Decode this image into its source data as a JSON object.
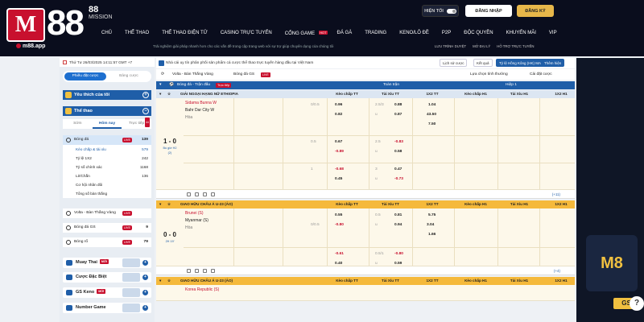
{
  "header": {
    "brand_main": "M",
    "brand_num": "88",
    "brand_badge": "88",
    "brand_sub": "MISSION",
    "app_link": "m88.app",
    "hide_label": "HIỆN TỐI",
    "login_label": "ĐĂNG NHẬP",
    "register_label": "ĐĂNG KÝ",
    "nav": [
      {
        "label": "CHỦ",
        "active": false
      },
      {
        "label": "THỂ THAO",
        "active": true
      },
      {
        "label": "THỂ THAO ĐIỆN TỬ",
        "active": false
      },
      {
        "label": "CASINO TRỰC TUYẾN",
        "active": false
      },
      {
        "label": "CỔNG GAME",
        "active": false,
        "badge": "HOT"
      },
      {
        "label": "ĐÁ GÀ",
        "active": false
      },
      {
        "label": "TRADING",
        "active": false
      },
      {
        "label": "KENO/LÔ ĐỀ",
        "active": false
      },
      {
        "label": "P2P",
        "active": false
      },
      {
        "label": "ĐỘC QUYỀN",
        "active": false
      },
      {
        "label": "KHUYẾN MÃI",
        "active": false
      },
      {
        "label": "VIP",
        "active": false
      }
    ],
    "marquee": "Trải nghiệm giải pháp nhanh hơn cho các vấn đề trong cập trang web với sự trợ giúp chuyên dụng của chúng tôi",
    "sub_links": [
      "LƯU TRÌNH DUYỆT",
      "MỞ ĐẠI LÝ",
      "HỖ TRỢ TRỰC TUYẾN"
    ],
    "datetime": "26/03/2025 14:12 (GMT+7)"
  },
  "left": {
    "datetime": "Thứ Tư 26/03/2025 14:11:57 GMT +7",
    "bet_tabs": [
      "Phiếu đặt cược",
      "Bảng cược"
    ],
    "favorites": "Yêu thích của tôi",
    "sports_header": "Thể thao",
    "sub_tabs": [
      {
        "label": "Sớm",
        "active": false
      },
      {
        "label": "Hôm nay",
        "active": true
      },
      {
        "label": "Trực tiếp",
        "active": false,
        "count": "44"
      }
    ],
    "football": {
      "label": "Bóng đá",
      "live": "LIVE",
      "count": "139"
    },
    "sub_items": [
      {
        "label": "Kèo chấp & tài xỉu",
        "count": "579",
        "selected": true
      },
      {
        "label": "Tỷ lệ 1X2",
        "count": "242"
      },
      {
        "label": "Tỷ số chính xác",
        "count": "1168"
      },
      {
        "label": "Lẻ/Chẵn",
        "count": "136"
      },
      {
        "label": "Cơ hội nhân đôi",
        "count": ""
      },
      {
        "label": "Tổng số bàn thắng",
        "count": ""
      }
    ],
    "other_sports": [
      {
        "label": "Volta - Bàn Thắng Vàng",
        "live": "LIVE",
        "count": ""
      },
      {
        "label": "Bóng đá GS",
        "live": "LIVE",
        "count": "9"
      },
      {
        "label": "Bóng rổ",
        "live": "LIVE",
        "count": "79"
      }
    ],
    "bottom_items": [
      {
        "label": "Muay Thai",
        "badge": "MỚI"
      },
      {
        "label": "Cược Đặc Biệt",
        "badge": ""
      },
      {
        "label": "GS Keno",
        "badge": "MỚI"
      },
      {
        "label": "Number Game",
        "badge": ""
      }
    ]
  },
  "main": {
    "topbar_text": "Nhà cái uy tín phân phối sản phẩm cá cược thể thao trực tuyến hàng đầu tại Việt Nam",
    "top_right": [
      "Lịch sử cược",
      "Kết quả",
      "Tỷ lệ Hồng Kông (HK) MALAY",
      "Thêm hiện"
    ],
    "sport_title": "Bóng đá - Trận đấu",
    "live_badge": "Trực tiếp",
    "volta_tab": "Volta - Bàn Thắng Vàng",
    "gs_tab": "Bóng đá GS",
    "gs_badge": "LIVE",
    "sort_label": "Lựa chọn tính thường",
    "settings_label": "Cài đặt cược",
    "col_full": "Toàn trận",
    "col_half": "Hiệp 1",
    "col_heads": [
      "Kèo chấp TT",
      "Tài Xỉu TT",
      "1X2 TT",
      "Kèo chấp H1",
      "Tài Xỉu H1",
      "1X2 H1"
    ],
    "leagues": [
      {
        "name": "GIẢI NGOẠI HẠNG NỮ ETHIOPIA",
        "score": "1 - 0",
        "status": "Bù giờ H2",
        "min": "(2)",
        "home": "Sidama Bunna W",
        "away": "Bahr Dar City W",
        "draw": "Hòa",
        "rows": [
          {
            "hc1": "0/0.5",
            "o1": "0.96",
            "hc2": "",
            "o2": "0.82",
            "tx1": "2.5/3",
            "t1": "0.88",
            "tx2": "u",
            "t2": "0.87",
            "x1": "1.04",
            "x2": "43.50",
            "x3": "7.50"
          },
          {
            "hc1": "0.5",
            "o1": "0.67",
            "hc2": "",
            "o2": "-0.89",
            "tx1": "2.5",
            "t1": "-0.83",
            "tx2": "u",
            "t2": "0.58",
            "x1": "",
            "x2": "",
            "x3": ""
          },
          {
            "hc1": "1",
            "o1": "-0.68",
            "hc2": "",
            "o2": "0.45",
            "tx1": "3",
            "t1": "0.47",
            "tx2": "u",
            "t2": "-0.73",
            "x1": "",
            "x2": "",
            "x3": ""
          }
        ],
        "more": "(+11)"
      },
      {
        "name": "GIAO HỮU CHÂU Á U-23 (ẢO)",
        "score": "0 - 0",
        "status": "2H 19'",
        "min": "",
        "home": "Brunei (S)",
        "away": "Myanmar (S)",
        "draw": "Hòa",
        "rows": [
          {
            "hc1": "",
            "o1": "0.55",
            "hc2": "0/0.5",
            "o2": "-0.80",
            "tx1": "0.5",
            "t1": "0.81",
            "tx2": "u",
            "t2": "0.94",
            "x1": "5.75",
            "x2": "3.04",
            "x3": "1.66"
          },
          {
            "hc1": "",
            "o1": "-0.61",
            "hc2": "",
            "o2": "0.40",
            "tx1": "0.5/1",
            "t1": "-0.80",
            "tx2": "u",
            "t2": "0.59",
            "x1": "",
            "x2": "",
            "x3": ""
          }
        ],
        "more": "(+4)"
      },
      {
        "name": "GIAO HỮU CHÂU Á U-23 (ẢO)",
        "home": "Korea Republic (S)"
      }
    ]
  },
  "right": {
    "promo_text": "M8",
    "promo_sub": "GS",
    "chat": "?"
  }
}
